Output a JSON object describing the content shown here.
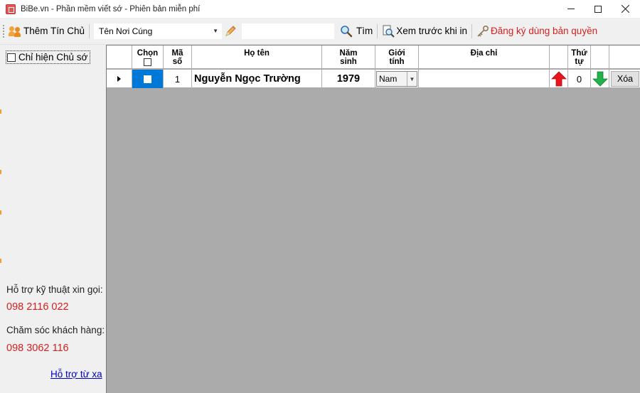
{
  "window": {
    "title": "BiBe.vn - Phần mềm viết sớ - Phiên bản miễn phí",
    "accent_color": "#0078d7"
  },
  "toolbar": {
    "add_owner_label": "Thêm Tín Chủ",
    "place_combo_value": "Tên Nơi Cúng",
    "search_value": "",
    "search_label": "Tìm",
    "preview_label": "Xem trước khi in",
    "register_label": "Đăng ký dùng bản quyền"
  },
  "left_panel": {
    "only_owner_label": "Chỉ hiện Chủ sớ",
    "only_owner_checked": false,
    "tech_support_label": "Hỗ trợ kỹ thuật xin gọi:",
    "tech_support_phone": "098 2116 022",
    "customer_care_label": "Chăm sóc khách hàng:",
    "customer_care_phone": "098 3062 116",
    "remote_support_link": "Hỗ trợ từ xa"
  },
  "grid": {
    "columns": [
      {
        "key": "chon",
        "label": "Chọn"
      },
      {
        "key": "ma_so",
        "label": "Mã\nsố"
      },
      {
        "key": "ho_ten",
        "label": "Họ tên"
      },
      {
        "key": "nam_sinh",
        "label": "Năm\nsinh"
      },
      {
        "key": "gioi_tinh",
        "label": "Giới\ntính"
      },
      {
        "key": "dia_chi",
        "label": "Địa chỉ"
      },
      {
        "key": "up",
        "label": ""
      },
      {
        "key": "thu_tu",
        "label": "Thứ\ntự"
      },
      {
        "key": "down",
        "label": ""
      },
      {
        "key": "xoa",
        "label": ""
      }
    ],
    "rows": [
      {
        "chon": false,
        "ma_so": "1",
        "ho_ten": "Nguyễn Ngọc Trường",
        "nam_sinh": "1979",
        "gioi_tinh": "Nam",
        "dia_chi": "",
        "thu_tu": "0",
        "delete_label": "Xóa"
      }
    ]
  }
}
